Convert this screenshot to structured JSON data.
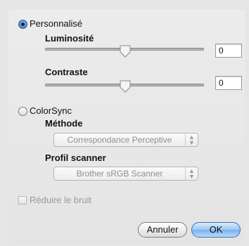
{
  "personal": {
    "label": "Personnalisé",
    "selected": true,
    "brightness": {
      "label": "Luminosité",
      "value": "0"
    },
    "contrast": {
      "label": "Contraste",
      "value": "0"
    }
  },
  "colorsync": {
    "label": "ColorSync",
    "selected": false,
    "method": {
      "label": "Méthode",
      "selected": "Correspondance Perceptive"
    },
    "profile": {
      "label": "Profil scanner",
      "selected": "Brother sRGB Scanner"
    }
  },
  "noise": {
    "label": "Réduire le bruit",
    "checked": false
  },
  "buttons": {
    "cancel": "Annuler",
    "ok": "OK"
  },
  "colors": {
    "accent": "#5a95dc"
  }
}
